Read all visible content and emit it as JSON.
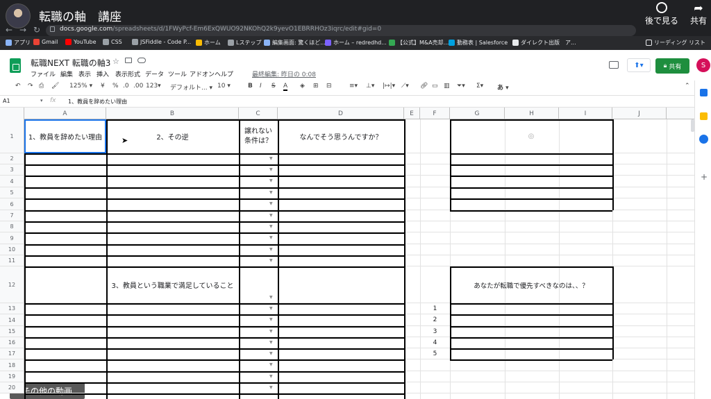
{
  "video": {
    "title": "転職の軸　講座",
    "watch_later": "後で見る",
    "share": "共有",
    "more_videos": "その他の動画"
  },
  "browser": {
    "url_host": "docs.google.com",
    "url_path": "/spreadsheets/d/1FWyPcf-Em6ExQWUO92NKOhQ2k9yevO1EBRRHOz3iqrc/edit#gid=0",
    "bookmarks": [
      {
        "label": "アプリ",
        "color": "#8ab4f8"
      },
      {
        "label": "Gmail",
        "color": "#ea4335"
      },
      {
        "label": "YouTube",
        "color": "#ff0000"
      },
      {
        "label": "CSS",
        "color": "#9aa0a6"
      },
      {
        "label": "JSFiddle - Code P...",
        "color": "#9aa0a6"
      },
      {
        "label": "ホーム",
        "color": "#fbbc04"
      },
      {
        "label": "Lステップ",
        "color": "#9aa0a6"
      },
      {
        "label": "編集画面: 驚くほど...",
        "color": "#8ab4f8"
      },
      {
        "label": "ホーム – redredhd...",
        "color": "#7b61ff"
      },
      {
        "label": "【公式】M&A売却...",
        "color": "#34a853"
      },
      {
        "label": "動務表 | Salesforce",
        "color": "#00a1e0"
      },
      {
        "label": "ダイレクト出版　ア...",
        "color": "#e8eaed"
      }
    ],
    "reading_list": "リーディング リスト"
  },
  "sheet": {
    "doc_title": "転職NEXT 転職の軸3",
    "menus": [
      "ファイル",
      "編集",
      "表示",
      "挿入",
      "表示形式",
      "データ",
      "ツール",
      "アドオン",
      "ヘルプ"
    ],
    "last_edit": "最終編集: 昨日の 0:08",
    "share_label": "共有",
    "user_initial": "S",
    "toolbar": {
      "zoom": "125%",
      "currency": "¥",
      "percent": "%",
      "dec_less": ".0",
      "dec_more": ".00",
      "format_123": "123▾",
      "font": "デフォルト...",
      "size": "10",
      "bold": "B",
      "italic": "I",
      "strike": "S",
      "text_color": "A",
      "input_tool": "あ"
    },
    "namebox": "A1",
    "formula_value": "1、教員を辞めたい理由",
    "columns": [
      "A",
      "B",
      "C",
      "D",
      "E",
      "F",
      "G",
      "H",
      "I",
      "J"
    ],
    "rows": [
      "1",
      "2",
      "3",
      "4",
      "5",
      "6",
      "7",
      "8",
      "9",
      "10",
      "11",
      "12",
      "13",
      "14",
      "15",
      "16",
      "17",
      "18",
      "19",
      "20"
    ],
    "cells": {
      "a1": "1、教員を辞めたい理由",
      "b1": "2、その逆",
      "c1_line1": "譲れない",
      "c1_line2": "条件は？",
      "d1": "なんでそう思うんですか？",
      "b12": "3、教員という職業で満足していること",
      "g12": "あなたが転職で優先すべきなのは、、？",
      "f_numbers": [
        "1",
        "2",
        "3",
        "4",
        "5"
      ]
    }
  }
}
